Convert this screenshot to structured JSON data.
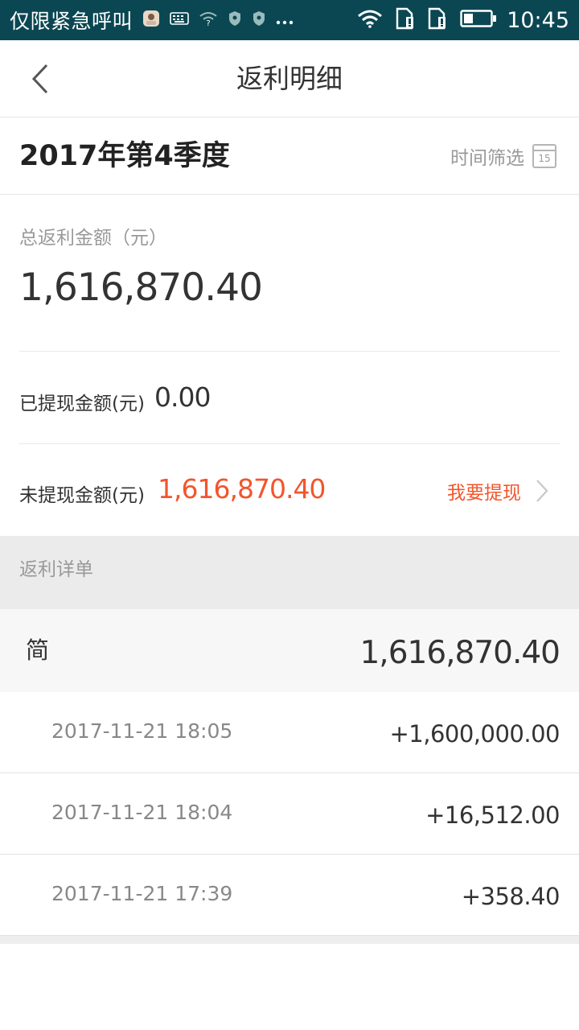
{
  "status_bar": {
    "carrier": "仅限紧急呼叫",
    "time": "10:45",
    "icons": [
      "avatar-icon",
      "keyboard-icon",
      "wifi-question-icon",
      "shield-icon",
      "shield-icon",
      "more-icon",
      "wifi-icon",
      "sim-icon",
      "sim-icon",
      "battery-icon"
    ]
  },
  "nav": {
    "title": "返利明细",
    "back_icon": "chevron-left-icon"
  },
  "period": {
    "title": "2017年第4季度",
    "filter_label": "时间筛选",
    "calendar_day": "15"
  },
  "summary": {
    "total_label": "总返利金额（元）",
    "total_value": "1,616,870.40",
    "withdrawn_label": "已提现金额(元)",
    "withdrawn_value": "0.00",
    "pending_label": "未提现金额(元)",
    "pending_value": "1,616,870.40",
    "withdraw_action": "我要提现"
  },
  "detail": {
    "header": "返利详单",
    "group_label": "简",
    "group_total": "1,616,870.40",
    "transactions": [
      {
        "date": "2017-11-21 18:05",
        "amount": "+1,600,000.00"
      },
      {
        "date": "2017-11-21 18:04",
        "amount": "+16,512.00"
      },
      {
        "date": "2017-11-21 17:39",
        "amount": "+358.40"
      }
    ]
  },
  "colors": {
    "status_bar_bg": "#0b4752",
    "accent_orange": "#f2552c",
    "section_bg": "#ebebeb"
  }
}
